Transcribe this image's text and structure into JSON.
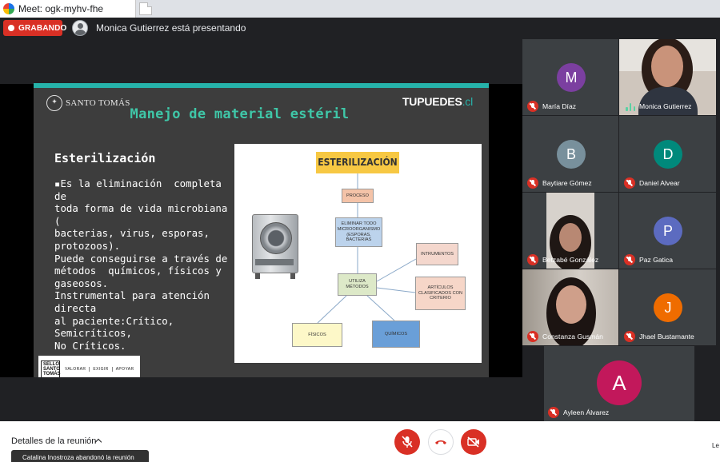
{
  "browser": {
    "tab_title": "Meet: ogk-myhv-fhe"
  },
  "meeting": {
    "recording_label": "GRABANDO",
    "presenting_text": "Monica Gutierrez está presentando"
  },
  "slide": {
    "institution": "SANTO TOMÁS",
    "title": "Manejo de material estéril",
    "brand_main": "TUPUEDES",
    "brand_suffix": ".cl",
    "heading": "Esterilización",
    "body_lines": [
      "▪Es la eliminación  completa de",
      "toda forma de vida microbiana (",
      "bacterias, virus, esporas,",
      "protozoos).",
      "Puede conseguirse a través de",
      "métodos  químicos, físicos y",
      "gaseosos.",
      "Instrumental para atención directa",
      "al paciente:Crítico, Semicríticos,",
      "No Críticos."
    ],
    "sello": {
      "box_lines": [
        "SELLO",
        "SANTO",
        "TOMÁS"
      ],
      "words": [
        "VALORAR",
        "EXIGIR",
        "APOYAR"
      ]
    },
    "diagram": {
      "title": "ESTERILIZACIÓN",
      "proceso": "PROCESO",
      "eliminar": "ELIMINAR TODO MICROORGANISMO (ESPORAS, BACTERIAS",
      "utiliza": "UTILIZA MÉTODOS",
      "intrumentos": "INTRUMENTOS",
      "articulos": "ARTÍCULOS CLASIFICADOS CON CRITERIO",
      "fisicos": "FÍSICOS",
      "quimicos": "QUÍMICOS"
    }
  },
  "participants": [
    {
      "name": "María Díaz",
      "initial": "M",
      "color": "#7b3fa0",
      "muted": true
    },
    {
      "name": "Monica Gutierrez",
      "initial": "",
      "color": "",
      "muted": false,
      "speaking": true,
      "video": true
    },
    {
      "name": "Baytiare Gómez",
      "initial": "B",
      "color": "#78909c",
      "muted": true
    },
    {
      "name": "Daniel Alvear",
      "initial": "D",
      "color": "#00897b",
      "muted": true
    },
    {
      "name": "Betzabé González",
      "initial": "",
      "color": "",
      "muted": true,
      "video": true
    },
    {
      "name": "Paz Gatica",
      "initial": "P",
      "color": "#5c6bc0",
      "muted": true
    },
    {
      "name": "Constanza Gusmán",
      "initial": "",
      "color": "",
      "muted": true,
      "video": true
    },
    {
      "name": "Jhael Bustamante",
      "initial": "J",
      "color": "#ef6c00",
      "muted": true
    },
    {
      "name": "Ayleen Álvarez",
      "initial": "A",
      "color": "#c2185b",
      "muted": true
    }
  ],
  "bottombar": {
    "details_label": "Detalles de la reunión",
    "toast": "Catalina Inostroza abandonó la reunión",
    "right_edge_text": "Le"
  }
}
